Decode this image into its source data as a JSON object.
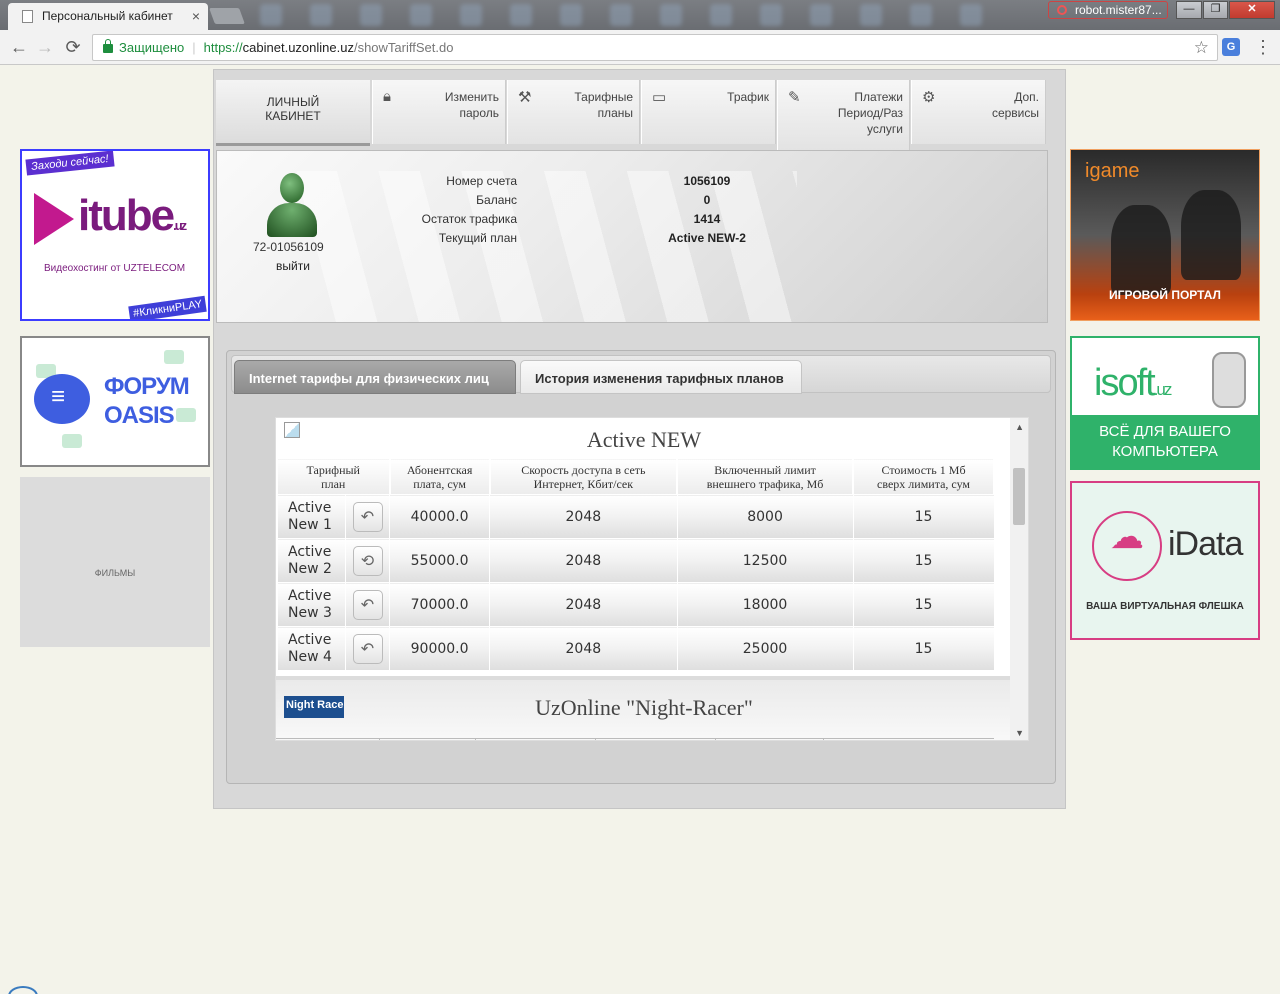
{
  "browser": {
    "tab_title": "Персональный кабинет",
    "tab_close": "×",
    "user_badge": "robot.mister87...",
    "min_label": "—",
    "max_label": "❐",
    "close_label": "✕",
    "back_icon": "←",
    "forward_icon": "→",
    "reload_icon": "⟳",
    "secure_label": "Защищено",
    "url_proto": "https://",
    "url_host": "cabinet.uzonline.uz",
    "url_path": "/showTariffSet.do",
    "bookmark_icon": "☆",
    "ext_label": "G",
    "menu_icon": "⋮"
  },
  "ads": {
    "itube": {
      "tag": "Заходи сейчас!",
      "logo": "itube",
      "logo_uz": ".uz",
      "sub": "Видеохостинг от UZTELECOM",
      "hashtag": "#КликниPLAY"
    },
    "forum": {
      "line1": "ФОРУМ",
      "line2": "OASIS"
    },
    "films": {
      "label": "ФИЛЬМЫ"
    },
    "igame": {
      "logo": "igame",
      "portal": "ИГРОВОЙ ПОРТАЛ"
    },
    "isoft": {
      "logo": "isoft",
      "logo_uz": ".uz",
      "line1": "ВСЁ ДЛЯ ВАШЕГО",
      "line2": "КОМПЬЮТЕРА"
    },
    "idata": {
      "logo": "iData",
      "sub": "ВАША ВИРТУАЛЬНАЯ ФЛЕШКА"
    }
  },
  "menu": {
    "home_line1": "ЛИЧНЫЙ",
    "home_line2": "КАБИНЕТ",
    "items": [
      {
        "line1": "Изменить",
        "line2": "пароль",
        "line3": ""
      },
      {
        "line1": "Тарифные",
        "line2": "планы",
        "line3": ""
      },
      {
        "line1": "Трафик",
        "line2": "",
        "line3": ""
      },
      {
        "line1": "Платежи",
        "line2": "Период/Раз",
        "line3": "услуги"
      },
      {
        "line1": "Доп.",
        "line2": "сервисы",
        "line3": ""
      }
    ]
  },
  "account": {
    "login": "72-01056109",
    "logout": "выйти",
    "labels": [
      "Номер счета",
      "Баланс",
      "Остаток трафика",
      "Текущий план"
    ],
    "values": [
      "1056109",
      "0",
      "1414",
      "Active NEW-2"
    ]
  },
  "tabs": {
    "active": "Internet тарифы для физических лиц",
    "inactive": "История изменения тарифных планов"
  },
  "tariffs": {
    "group1_title": "Active NEW",
    "headers": [
      [
        "Тарифный",
        "план"
      ],
      [
        "Абонентская",
        "плата, сум"
      ],
      [
        "Скорость доступа в сеть",
        "Интернет, Кбит/сек"
      ],
      [
        "Включенный лимит",
        "внешнего трафика, Мб"
      ],
      [
        "Стоимость 1 Мб",
        "сверх лимита, сум"
      ]
    ],
    "rows": [
      {
        "name1": "Active",
        "name2": "New 1",
        "icon": "↶",
        "fee": "40000.0",
        "speed": "2048",
        "limit": "8000",
        "extra": "15"
      },
      {
        "name1": "Active",
        "name2": "New 2",
        "icon": "⟲",
        "fee": "55000.0",
        "speed": "2048",
        "limit": "12500",
        "extra": "15"
      },
      {
        "name1": "Active",
        "name2": "New 3",
        "icon": "↶",
        "fee": "70000.0",
        "speed": "2048",
        "limit": "18000",
        "extra": "15"
      },
      {
        "name1": "Active",
        "name2": "New 4",
        "icon": "↶",
        "fee": "90000.0",
        "speed": "2048",
        "limit": "25000",
        "extra": "15"
      }
    ],
    "group2_title": "UzOnline \"Night-Racer\"",
    "group2_logo": "Night Racer",
    "scroll_up": "▲",
    "scroll_down": "▼"
  }
}
